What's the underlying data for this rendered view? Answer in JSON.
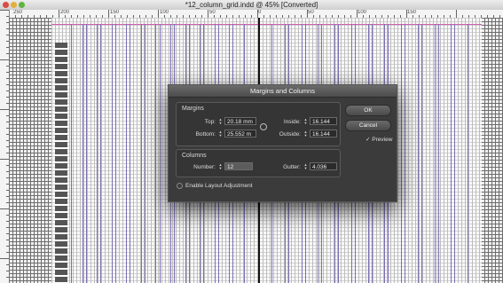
{
  "window": {
    "title": "*12_column_grid.indd @ 45% [Converted]"
  },
  "ruler": {
    "labels": [
      "250",
      "200",
      "150",
      "100",
      "50",
      "0",
      "50",
      "100",
      "150"
    ]
  },
  "dialog": {
    "title": "Margins and Columns",
    "margins": {
      "legend": "Margins",
      "top_label": "Top:",
      "top_value": "20.18 mm",
      "bottom_label": "Bottom:",
      "bottom_value": "25.552 m",
      "inside_label": "Inside:",
      "inside_value": "16.144 m",
      "outside_label": "Outside:",
      "outside_value": "16.144 m"
    },
    "columns": {
      "legend": "Columns",
      "number_label": "Number:",
      "number_value": "12",
      "gutter_label": "Gutter:",
      "gutter_value": "4.036 mm"
    },
    "enable_layout_adjustment": {
      "label": "Enable Layout Adjustment",
      "checked": false
    },
    "buttons": {
      "ok": "OK",
      "cancel": "Cancel"
    },
    "preview": {
      "label": "Preview",
      "checked": true,
      "check_glyph": "✓"
    }
  }
}
